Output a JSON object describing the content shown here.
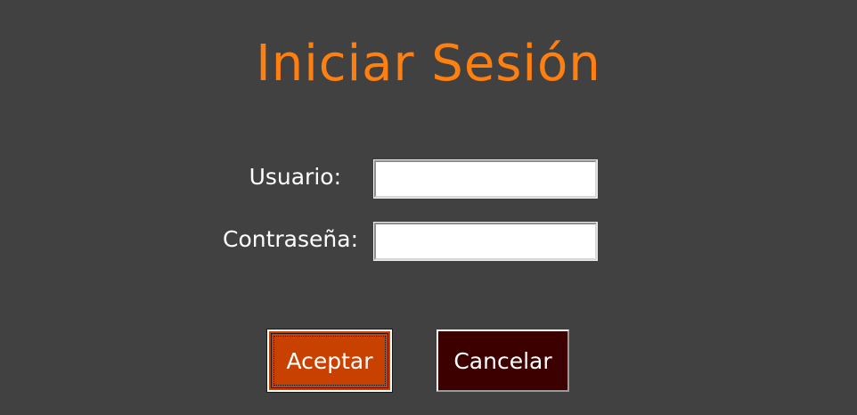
{
  "title": "Iniciar Sesión",
  "form": {
    "user_label": "Usuario:",
    "user_value": "",
    "password_label": "Contraseña:",
    "password_value": ""
  },
  "buttons": {
    "accept_label": "Aceptar",
    "cancel_label": "Cancelar"
  },
  "colors": {
    "background": "#414141",
    "title": "#ff7f0f",
    "accept_button": "#c84100",
    "cancel_button": "#3d0000"
  }
}
